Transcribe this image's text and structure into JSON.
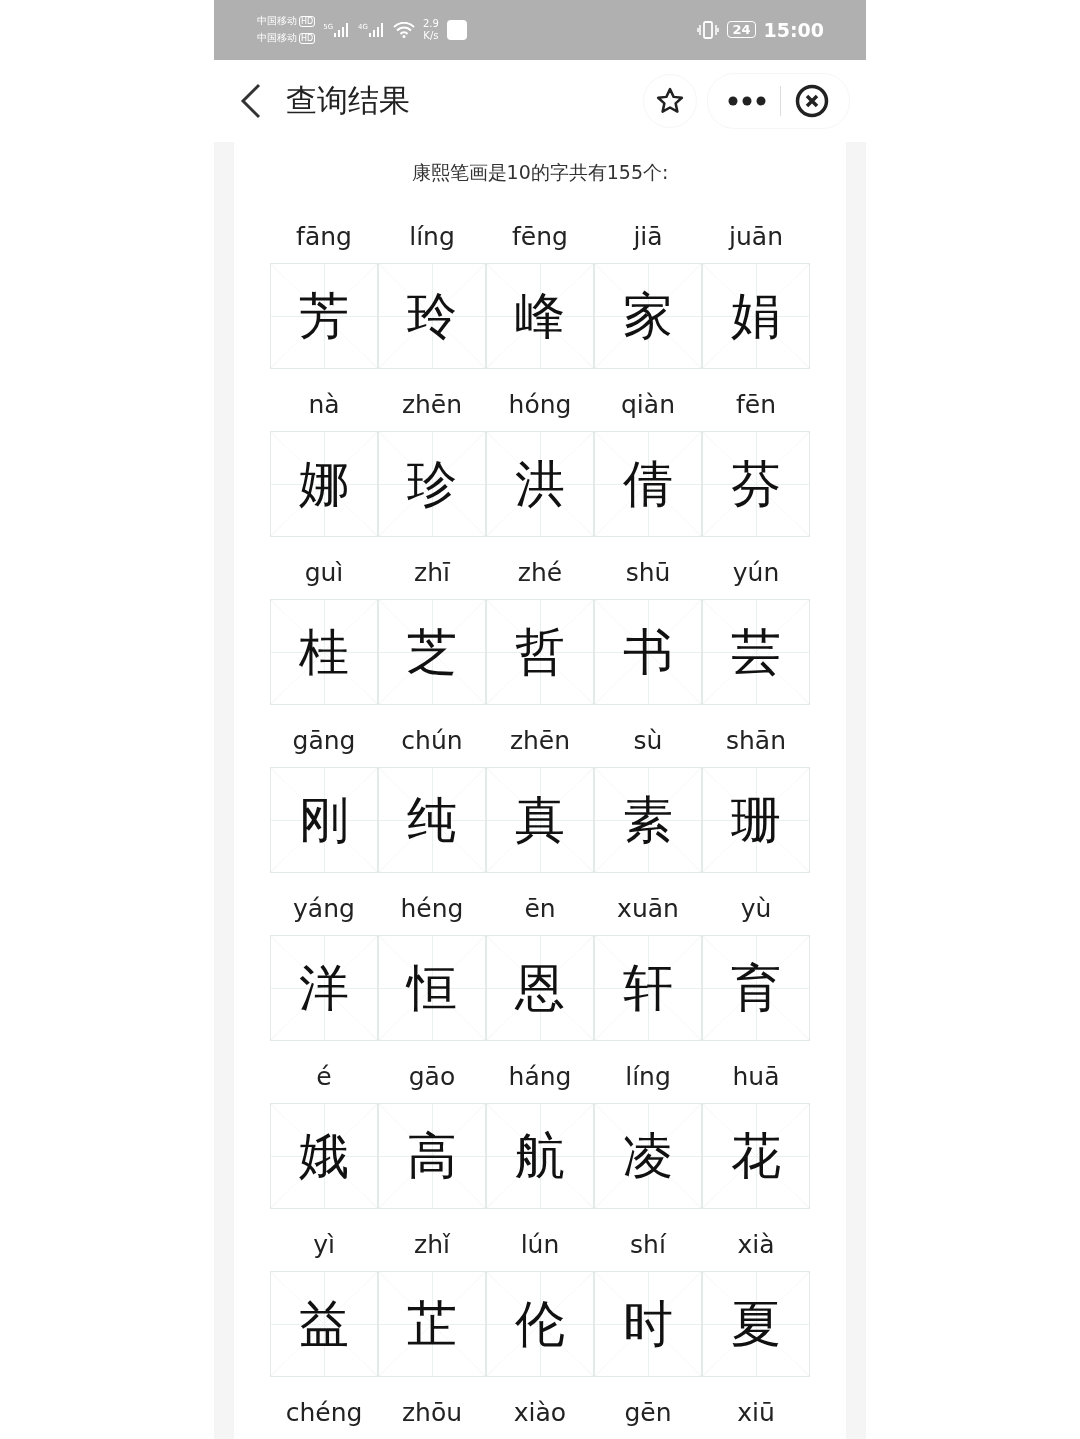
{
  "status_bar": {
    "carriers": [
      {
        "name": "中国移动",
        "badge": "HD"
      },
      {
        "name": "中国移动",
        "badge": "HD"
      }
    ],
    "signals": [
      "5G",
      "4G"
    ],
    "speed": [
      "2.9",
      "K/s"
    ],
    "battery": "24",
    "time": "15:00"
  },
  "header": {
    "title": "查询结果"
  },
  "summary": "康熙笔画是10的字共有155个:",
  "characters": [
    {
      "pinyin": "fāng",
      "char": "芳"
    },
    {
      "pinyin": "líng",
      "char": "玲"
    },
    {
      "pinyin": "fēng",
      "char": "峰"
    },
    {
      "pinyin": "jiā",
      "char": "家"
    },
    {
      "pinyin": "juān",
      "char": "娟"
    },
    {
      "pinyin": "nà",
      "char": "娜"
    },
    {
      "pinyin": "zhēn",
      "char": "珍"
    },
    {
      "pinyin": "hóng",
      "char": "洪"
    },
    {
      "pinyin": "qiàn",
      "char": "倩"
    },
    {
      "pinyin": "fēn",
      "char": "芬"
    },
    {
      "pinyin": "guì",
      "char": "桂"
    },
    {
      "pinyin": "zhī",
      "char": "芝"
    },
    {
      "pinyin": "zhé",
      "char": "哲"
    },
    {
      "pinyin": "shū",
      "char": "书"
    },
    {
      "pinyin": "yún",
      "char": "芸"
    },
    {
      "pinyin": "gāng",
      "char": "刚"
    },
    {
      "pinyin": "chún",
      "char": "纯"
    },
    {
      "pinyin": "zhēn",
      "char": "真"
    },
    {
      "pinyin": "sù",
      "char": "素"
    },
    {
      "pinyin": "shān",
      "char": "珊"
    },
    {
      "pinyin": "yáng",
      "char": "洋"
    },
    {
      "pinyin": "héng",
      "char": "恒"
    },
    {
      "pinyin": "ēn",
      "char": "恩"
    },
    {
      "pinyin": "xuān",
      "char": "轩"
    },
    {
      "pinyin": "yù",
      "char": "育"
    },
    {
      "pinyin": "é",
      "char": "娥"
    },
    {
      "pinyin": "gāo",
      "char": "高"
    },
    {
      "pinyin": "háng",
      "char": "航"
    },
    {
      "pinyin": "líng",
      "char": "凌"
    },
    {
      "pinyin": "huā",
      "char": "花"
    },
    {
      "pinyin": "yì",
      "char": "益"
    },
    {
      "pinyin": "zhǐ",
      "char": "芷"
    },
    {
      "pinyin": "lún",
      "char": "伦"
    },
    {
      "pinyin": "shí",
      "char": "时"
    },
    {
      "pinyin": "xià",
      "char": "夏"
    },
    {
      "pinyin": "chéng"
    },
    {
      "pinyin": "zhōu"
    },
    {
      "pinyin": "xiào"
    },
    {
      "pinyin": "gēn"
    },
    {
      "pinyin": "xiū"
    }
  ]
}
